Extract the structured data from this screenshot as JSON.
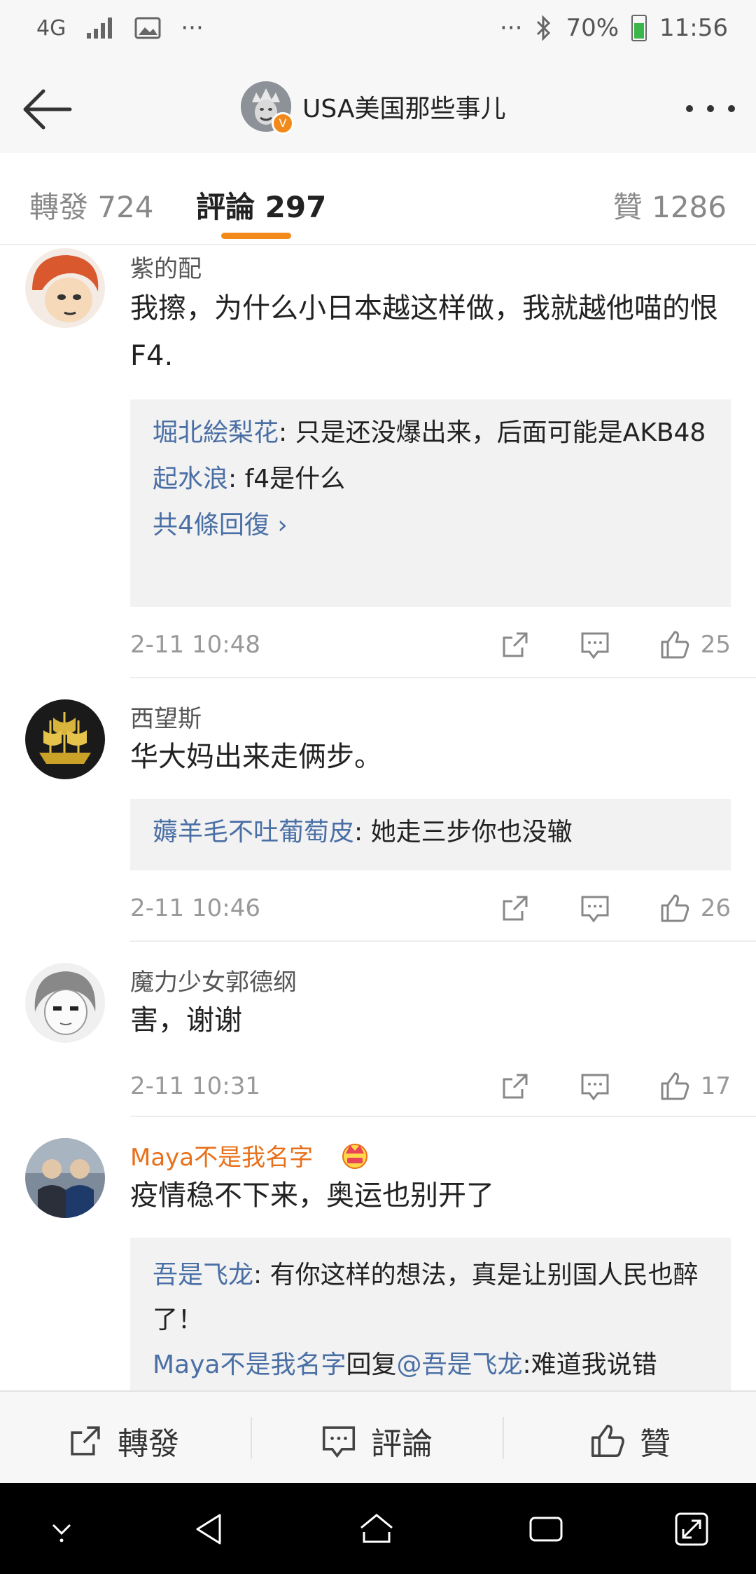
{
  "status_bar": {
    "network": "4G",
    "overflow": "···",
    "overflow_right": "···",
    "battery": "70%",
    "time": "11:56"
  },
  "header": {
    "title": "USA美国那些事儿",
    "verified_badge": "V"
  },
  "tabs": [
    {
      "label": "轉發 724"
    },
    {
      "label": "評論 297"
    },
    {
      "label": "贊 1286"
    }
  ],
  "comments": [
    {
      "user": "紫的配",
      "text": "我擦，为什么小日本越这样做，我就越他喵的恨F4.",
      "replies": [
        {
          "name": "堀北絵梨花",
          "text": ": 只是还没爆出来，后面可能是AKB48"
        },
        {
          "name": "起水浪",
          "text": ": f4是什么"
        }
      ],
      "more_replies": "共4條回復 ›",
      "time": "2-11 10:48",
      "likes": "25"
    },
    {
      "user": "西望斯",
      "text": "华大妈出来走俩步。",
      "replies": [
        {
          "name": "薅羊毛不吐葡萄皮",
          "text": ": 她走三步你也没辙"
        }
      ],
      "time": "2-11 10:46",
      "likes": "26"
    },
    {
      "user": "魔力少女郭德纲",
      "text": "害，谢谢",
      "time": "2-11 10:31",
      "likes": "17"
    },
    {
      "user": "Maya不是我名字",
      "text": "疫情稳不下来，奥运也别开了",
      "replies": [
        {
          "name": "吾是飞龙",
          "text": ": 有你这样的想法，真是让别国人民也醉了！"
        }
      ],
      "reply2": {
        "name": "Maya不是我名字",
        "mid": "回复",
        "mention": "@吾是飞龙",
        "text": ":难道我说错"
      }
    }
  ],
  "bottom_bar": {
    "repost": "轉發",
    "comment": "評論",
    "like": "贊"
  },
  "colors": {
    "accent": "#f28a1b",
    "link": "#4a6fa5",
    "vip_name": "#e8701a"
  }
}
